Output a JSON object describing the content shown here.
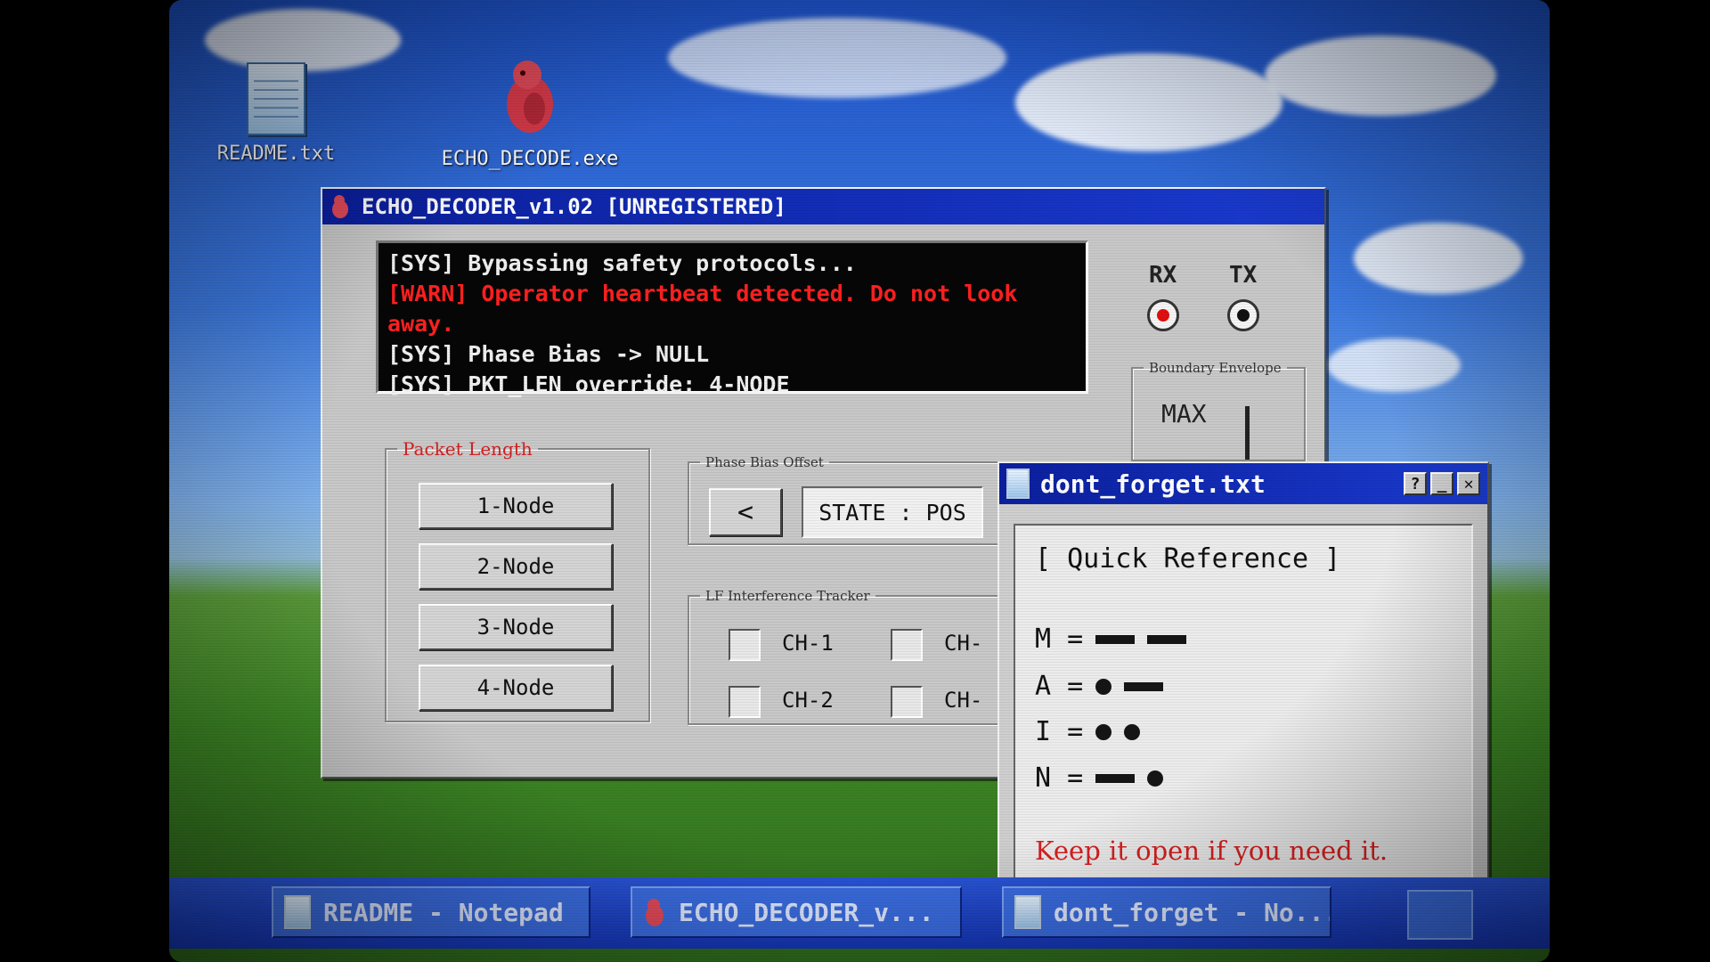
{
  "desktop": {
    "icons": [
      {
        "label": "README.txt",
        "icon": "notepad-icon"
      },
      {
        "label": "ECHO_DECODE.exe",
        "icon": "red-bird-icon"
      }
    ]
  },
  "decoder_window": {
    "title": "ECHO_DECODER_v1.02 [UNREGISTERED]",
    "console": {
      "lines": [
        {
          "text": "[SYS] Bypassing safety protocols...",
          "level": "sys"
        },
        {
          "text": "[WARN] Operator heartbeat detected. Do not look away.",
          "level": "warn"
        },
        {
          "text": "[SYS] Phase Bias -> NULL",
          "level": "sys"
        },
        {
          "text": "[SYS] PKT_LEN override: 4-NODE",
          "level": "sys"
        }
      ]
    },
    "indicators": {
      "rx_label": "RX",
      "tx_label": "TX",
      "rx_color": "#e01010",
      "tx_color": "#111111"
    },
    "boundary_envelope": {
      "label": "Boundary Envelope",
      "value": "MAX"
    },
    "packet_length": {
      "label": "Packet Length",
      "buttons": [
        "1-Node",
        "2-Node",
        "3-Node",
        "4-Node"
      ]
    },
    "phase_bias": {
      "label": "Phase Bias Offset",
      "prev_label": "<",
      "state": "STATE : POS"
    },
    "lf_tracker": {
      "label": "LF Interference Tracker",
      "channels": [
        "CH-1",
        "CH-",
        "CH-2",
        "CH-"
      ]
    }
  },
  "notepad_window": {
    "title": "dont_forget.txt",
    "help_label": "?",
    "minimize_label": "_",
    "close_label": "✕",
    "heading": "[ Quick Reference ]",
    "morse": [
      {
        "letter": "M =",
        "code": [
          "dash",
          "dash"
        ]
      },
      {
        "letter": "A =",
        "code": [
          "dot",
          "dash"
        ]
      },
      {
        "letter": "I =",
        "code": [
          "dot",
          "dot"
        ]
      },
      {
        "letter": "N =",
        "code": [
          "dash",
          "dot"
        ]
      }
    ],
    "footer": "Keep it open if you need it."
  },
  "taskbar": {
    "items": [
      {
        "label": "README - Notepad",
        "icon": "notepad-icon"
      },
      {
        "label": "ECHO_DECODER_v...",
        "icon": "red-bird-icon"
      },
      {
        "label": "dont_forget - No...",
        "icon": "notepad-icon"
      }
    ]
  },
  "colors": {
    "accent": "#0b1f9e",
    "warn": "#ff2020",
    "packet_label": "#d02020",
    "footer_text": "#d82020"
  }
}
